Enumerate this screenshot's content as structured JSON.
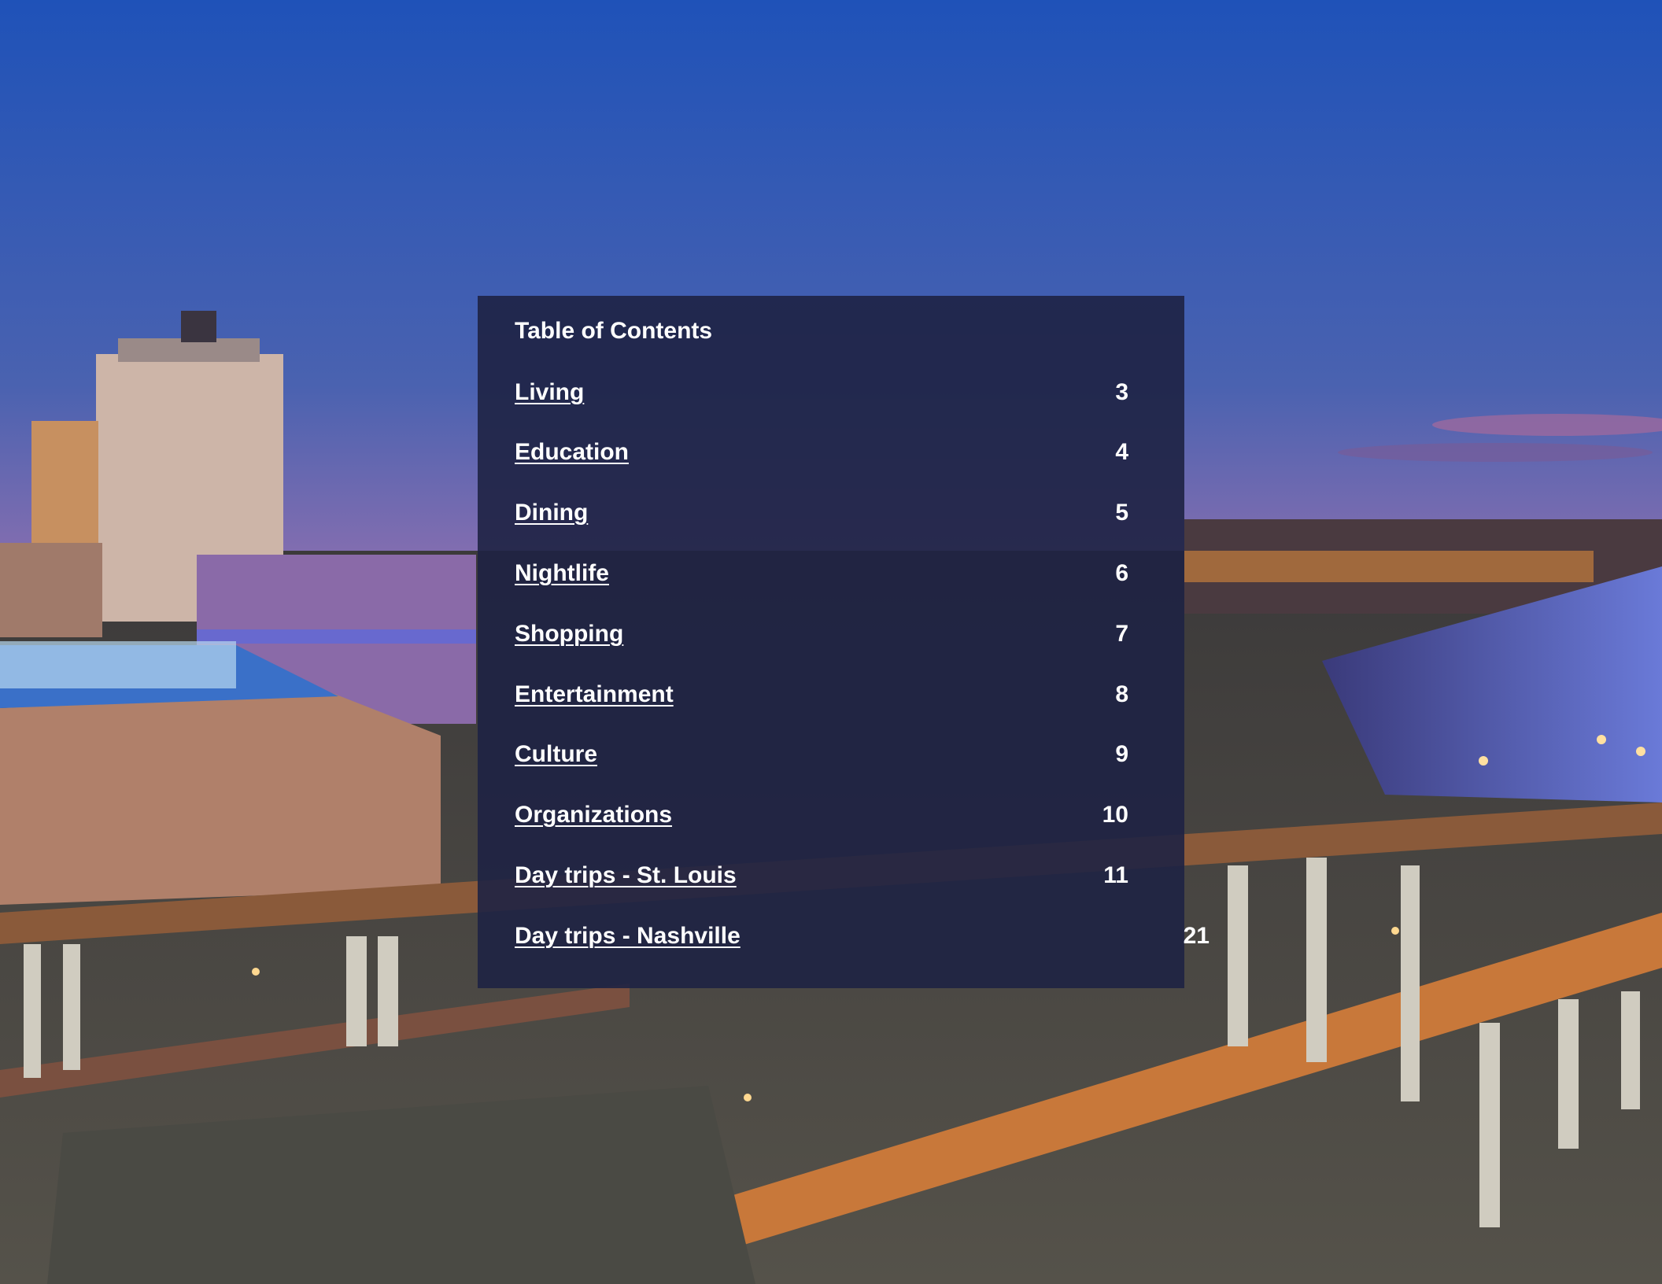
{
  "toc": {
    "title": "Table of Contents",
    "entries": [
      {
        "label": "Living",
        "page": "3"
      },
      {
        "label": "Education",
        "page": "4"
      },
      {
        "label": "Dining",
        "page": "5"
      },
      {
        "label": "Nightlife",
        "page": "6"
      },
      {
        "label": "Shopping",
        "page": "7"
      },
      {
        "label": "Entertainment",
        "page": "8"
      },
      {
        "label": "Culture",
        "page": "9"
      },
      {
        "label": "Organizations",
        "page": "10"
      },
      {
        "label": "Day trips - St. Louis",
        "page": "11"
      },
      {
        "label": "Day trips - Nashville",
        "page": "21"
      }
    ]
  },
  "colors": {
    "panel": "#1e2244",
    "text": "#ffffff",
    "sky_top": "#1f52b8",
    "sky_bottom": "#c07ab8",
    "city_light": "#e8903a"
  }
}
